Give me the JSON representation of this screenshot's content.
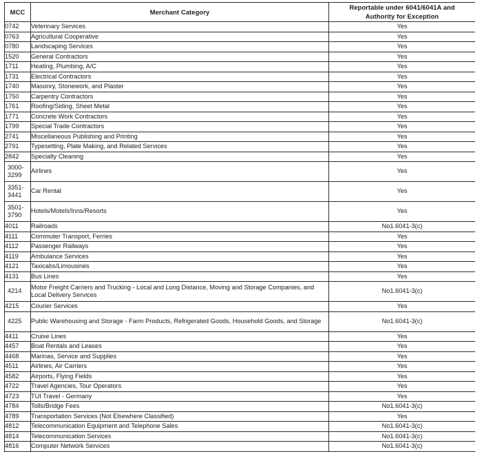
{
  "table": {
    "headers": {
      "mcc": "MCC",
      "category": "Merchant Category",
      "reportable_line1": "Reportable under 6041/6041A and",
      "reportable_line2": "Authority for Exception"
    },
    "values": {
      "yes": "Yes",
      "exception": "No1.6041-3(c)"
    },
    "rows": [
      {
        "mcc": "0742",
        "category": "Veterinary Services",
        "reportable": "Yes"
      },
      {
        "mcc": "0763",
        "category": "Agricultural Cooperative",
        "reportable": "Yes"
      },
      {
        "mcc": "0780",
        "category": "Landscaping Services",
        "reportable": "Yes"
      },
      {
        "mcc": "1520",
        "category": "General Contractors",
        "reportable": "Yes"
      },
      {
        "mcc": "1711",
        "category": "Heating, Plumbing, A/C",
        "reportable": "Yes"
      },
      {
        "mcc": "1731",
        "category": "Electrical Contractors",
        "reportable": "Yes"
      },
      {
        "mcc": "1740",
        "category": "Masonry, Stonework, and Plaster",
        "reportable": "Yes"
      },
      {
        "mcc": "1750",
        "category": "Carpentry Contractors",
        "reportable": "Yes"
      },
      {
        "mcc": "1761",
        "category": "Roofing/Siding, Sheet Metal",
        "reportable": "Yes"
      },
      {
        "mcc": "1771",
        "category": "Concrete Work Contractors",
        "reportable": "Yes"
      },
      {
        "mcc": "1799",
        "category": "Special Trade Contractors",
        "reportable": "Yes"
      },
      {
        "mcc": "2741",
        "category": "Miscellaneous Publishing and Printing",
        "reportable": "Yes"
      },
      {
        "mcc": "2791",
        "category": "Typesetting, Plate Making, and Related Services",
        "reportable": "Yes"
      },
      {
        "mcc": "2842",
        "category": "Specialty Cleaning",
        "reportable": "Yes"
      },
      {
        "mcc": "3000-3299",
        "category": "Airlines",
        "reportable": "Yes",
        "tall": true
      },
      {
        "mcc": "3351-3441",
        "category": "Car Rental",
        "reportable": "Yes",
        "tall": true
      },
      {
        "mcc": "3501-3790",
        "category": "Hotels/Motels/Inns/Resorts",
        "reportable": "Yes",
        "tall": true
      },
      {
        "mcc": "4011",
        "category": "Railroads",
        "reportable": "No1.6041-3(c)"
      },
      {
        "mcc": "4111",
        "category": "Commuter Transport, Ferries",
        "reportable": "Yes"
      },
      {
        "mcc": "4112",
        "category": "Passenger Railways",
        "reportable": "Yes"
      },
      {
        "mcc": "4119",
        "category": "Ambulance Services",
        "reportable": "Yes"
      },
      {
        "mcc": "4121",
        "category": "Taxicabs/Limousines",
        "reportable": "Yes"
      },
      {
        "mcc": "4131",
        "category": "Bus Lines",
        "reportable": "Yes"
      },
      {
        "mcc": "4214",
        "category": "Motor Freight Carriers and Trucking - Local and Long Distance, Moving and Storage Companies, and Local Delivery Services",
        "reportable": "No1.6041-3(c)",
        "tall": true
      },
      {
        "mcc": "4215",
        "category": "Courier Services",
        "reportable": "Yes"
      },
      {
        "mcc": "4225",
        "category": "Public Warehousing and Storage - Farm Products, Refrigerated Goods, Household Goods, and Storage",
        "reportable": "No1.6041-3(c)",
        "tall": true
      },
      {
        "mcc": "4411",
        "category": "Cruise Lines",
        "reportable": "Yes"
      },
      {
        "mcc": "4457",
        "category": "Boat Rentals and Leases",
        "reportable": "Yes"
      },
      {
        "mcc": "4468",
        "category": "Marinas, Service and Supplies",
        "reportable": "Yes"
      },
      {
        "mcc": "4511",
        "category": "Airlines, Air Carriers",
        "reportable": "Yes"
      },
      {
        "mcc": "4582",
        "category": "Airports, Flying Fields",
        "reportable": "Yes"
      },
      {
        "mcc": "4722",
        "category": "Travel Agencies, Tour Operators",
        "reportable": "Yes"
      },
      {
        "mcc": "4723",
        "category": "TUI Travel - Germany",
        "reportable": "Yes"
      },
      {
        "mcc": "4784",
        "category": "Tolls/Bridge Fees",
        "reportable": "No1.6041-3(c)"
      },
      {
        "mcc": "4789",
        "category": "Transportation Services (Not Elsewhere Classified)",
        "reportable": "Yes"
      },
      {
        "mcc": "4812",
        "category": "Telecommunication Equipment and Telephone Sales",
        "reportable": "No1.6041-3(c)"
      },
      {
        "mcc": "4814",
        "category": "Telecommunication Services",
        "reportable": "No1.6041-3(c)"
      },
      {
        "mcc": "4816",
        "category": "Computer Network Services",
        "reportable": "No1.6041-3(c)"
      }
    ]
  }
}
